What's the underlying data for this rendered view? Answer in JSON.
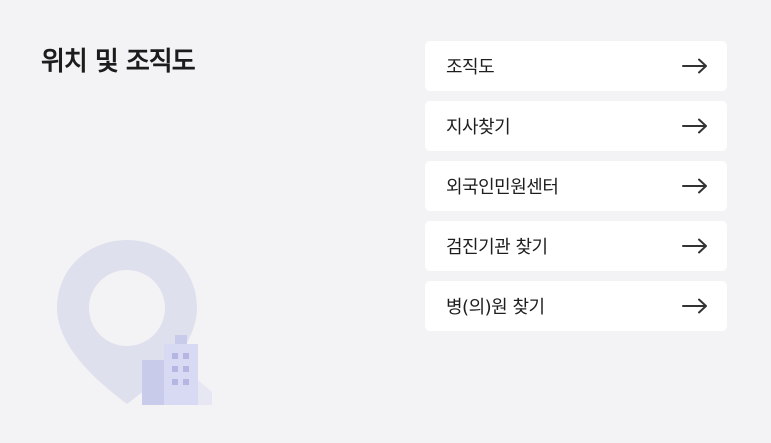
{
  "section": {
    "title": "위치 및 조직도"
  },
  "links": [
    {
      "label": "조직도",
      "icon": "arrow-right-icon"
    },
    {
      "label": "지사찾기",
      "icon": "arrow-right-icon"
    },
    {
      "label": "외국인민원센터",
      "icon": "arrow-right-icon"
    },
    {
      "label": "검진기관 찾기",
      "icon": "arrow-right-icon"
    },
    {
      "label": "병(의)원 찾기",
      "icon": "arrow-right-icon"
    }
  ],
  "illustration": {
    "icon": "location-pin-building-icon",
    "colors": {
      "pin": "#dfe0ee",
      "building_front": "#c9cbea",
      "building_back": "#d8d9f2",
      "window": "#b5b7e2"
    }
  },
  "colors": {
    "background": "#f3f3f5",
    "card": "#ffffff",
    "text": "#1e1e1e",
    "arrow": "#333333"
  }
}
